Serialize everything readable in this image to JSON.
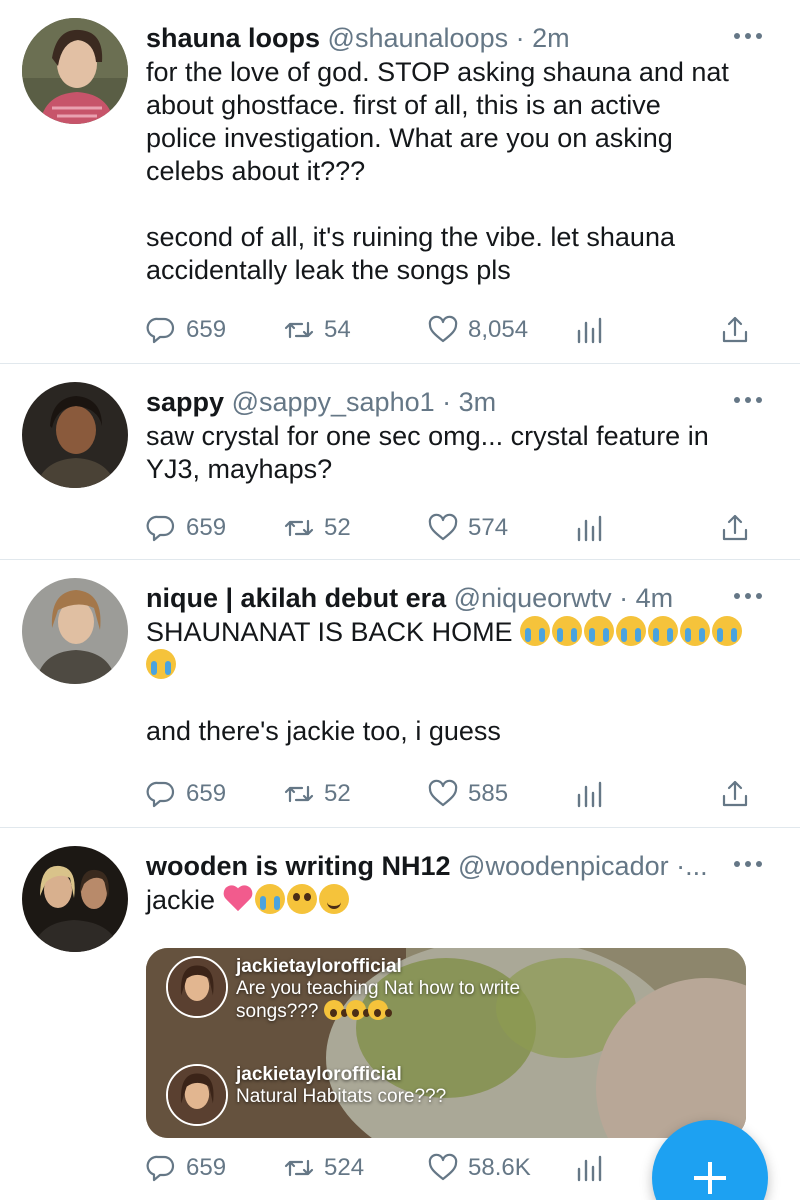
{
  "tweets": [
    {
      "name": "shauna loops",
      "handle": "@shaunaloops · 2m",
      "text_lines": [
        "for the love of god. STOP asking shauna and nat",
        "about ghostface. first of all, this is an active",
        "police investigation. What are you on asking",
        "celebs about it???"
      ],
      "text_lines_2": [
        "second of all, it's ruining the vibe. let shauna",
        "accidentally leak the songs pls"
      ],
      "replies": "659",
      "retweets": "54",
      "likes": "8,054"
    },
    {
      "name": "sappy",
      "handle": "@sappy_sapho1 · 3m",
      "text_lines": [
        "saw crystal for one sec omg... crystal feature in",
        "YJ3, mayhaps?"
      ],
      "replies": "659",
      "retweets": "52",
      "likes": "574"
    },
    {
      "name": "nique | akilah debut era",
      "handle": "@niqueorwtv · 4m",
      "text_line_1": "SHAUNANAT IS BACK HOME",
      "text_line_3": "and there's jackie too, i guess",
      "replies": "659",
      "retweets": "52",
      "likes": "585"
    },
    {
      "name": "wooden is writing NH12",
      "handle": "@woodenpicador ·...",
      "text": "jackie",
      "replies": "659",
      "retweets": "524",
      "likes": "58.6K",
      "media": {
        "comment_1_user": "jackietaylorofficial",
        "comment_1_text_a": "Are you teaching Nat how to write",
        "comment_1_text_b": "songs???",
        "comment_2_user": "jackietaylorofficial",
        "comment_2_text": "Natural Habitats core???"
      }
    }
  ],
  "icons": {
    "reply": "reply-icon",
    "retweet": "retweet-icon",
    "like": "heart-icon",
    "stats": "stats-icon",
    "share": "share-icon",
    "compose": "plus-icon"
  },
  "colors": {
    "accent": "#1da1f2",
    "secondary_text": "#657786",
    "divider": "#e1e8ed"
  }
}
